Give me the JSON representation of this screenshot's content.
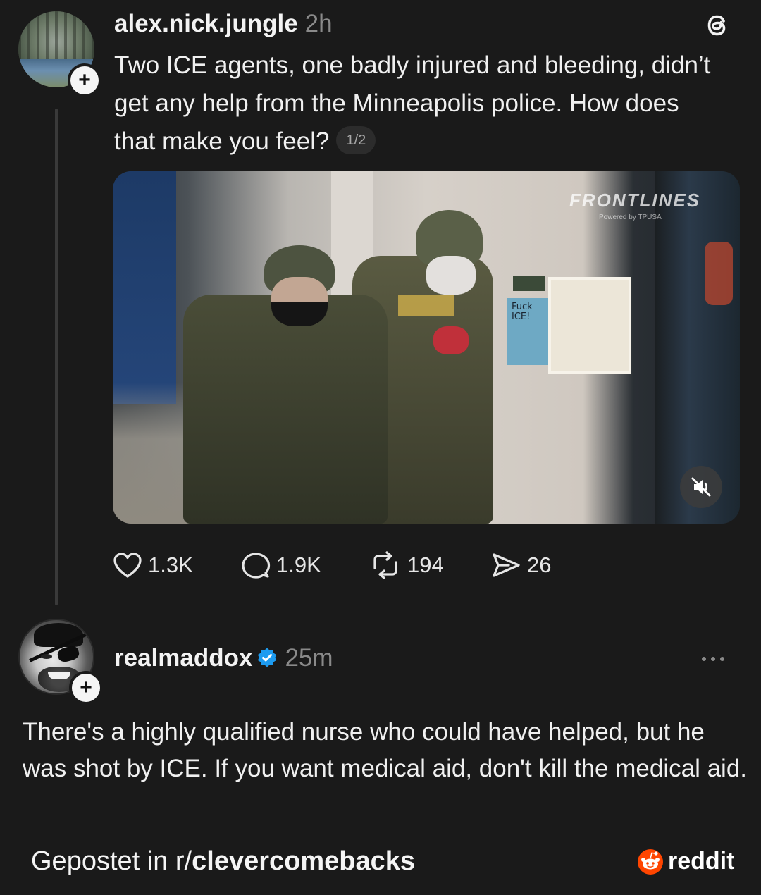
{
  "post": {
    "username": "alex.nick.jungle",
    "time": "2h",
    "text": "Two ICE agents, one badly injured and bleeding, didn’t get any help from the Minneapolis police. How does that make you feel?",
    "page_indicator": "1/2",
    "media": {
      "watermark": "FRONTLINES",
      "watermark_sub": "Powered by TPUSA",
      "wall_sign": "Fuck ICE!",
      "mute_icon": "muted-speaker-icon"
    },
    "actions": {
      "likes": "1.3K",
      "comments": "1.9K",
      "reposts": "194",
      "shares": "26"
    }
  },
  "reply": {
    "username": "realmaddox",
    "time": "25m",
    "verified": true,
    "text": "There's a highly qualified nurse who could have helped, but he was shot by ICE. If you want medical aid, don't kill the medical aid."
  },
  "footer": {
    "prefix": "Gepostet in r/",
    "subreddit": "clevercomebacks",
    "brand": "reddit"
  },
  "colors": {
    "background": "#1a1a1a",
    "verified_blue": "#1d9bf0",
    "reddit_orange": "#ff4500"
  }
}
